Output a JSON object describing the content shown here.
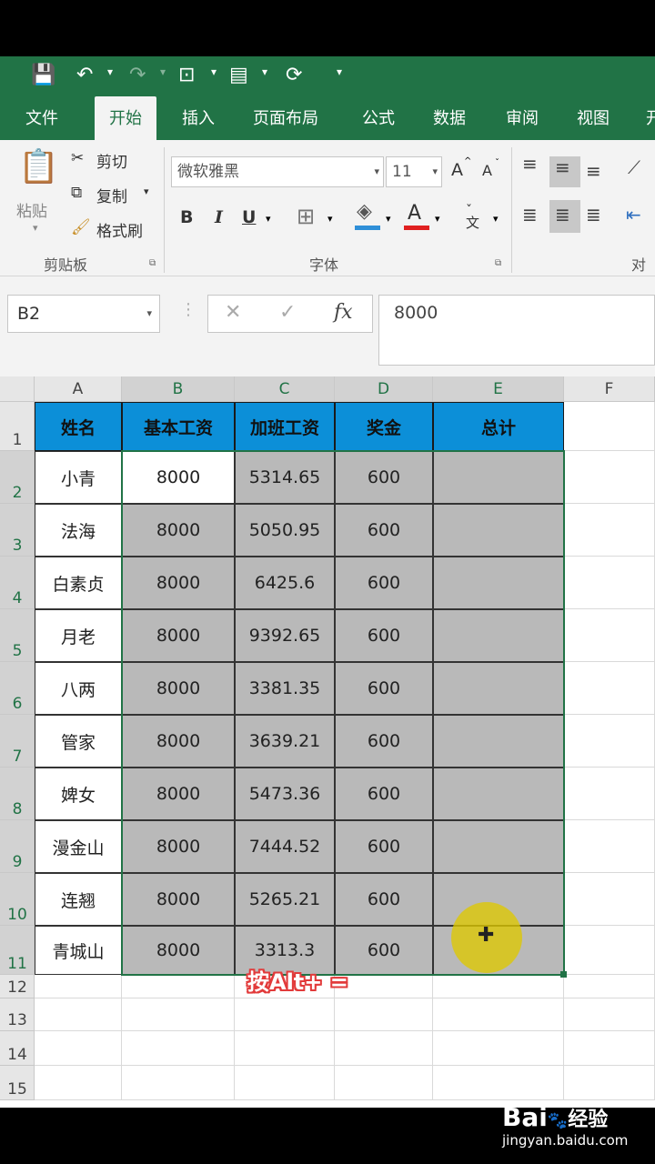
{
  "ribbon_tabs": [
    "文件",
    "开始",
    "插入",
    "页面布局",
    "公式",
    "数据",
    "审阅",
    "视图",
    "开"
  ],
  "active_tab": "开始",
  "clipboard": {
    "paste": "粘贴",
    "cut": "剪切",
    "copy": "复制",
    "format_painter": "格式刷",
    "group": "剪贴板"
  },
  "font": {
    "name": "微软雅黑",
    "size": "11",
    "grow": "A",
    "shrink": "A",
    "bold": "B",
    "italic": "I",
    "underline": "U",
    "color_letter": "A",
    "wen": "文",
    "group": "字体"
  },
  "align": {
    "group": "对齐"
  },
  "formula_bar": {
    "name_box": "B2",
    "cancel": "✕",
    "enter": "✓",
    "fx": "fx",
    "value": "8000"
  },
  "columns": [
    "A",
    "B",
    "C",
    "D",
    "E",
    "F"
  ],
  "rows": [
    "1",
    "2",
    "3",
    "4",
    "5",
    "6",
    "7",
    "8",
    "9",
    "10",
    "11",
    "12",
    "13",
    "14",
    "15"
  ],
  "table": {
    "headers": [
      "姓名",
      "基本工资",
      "加班工资",
      "奖金",
      "总计"
    ],
    "rows": [
      [
        "小青",
        "8000",
        "5314.65",
        "600",
        ""
      ],
      [
        "法海",
        "8000",
        "5050.95",
        "600",
        ""
      ],
      [
        "白素贞",
        "8000",
        "6425.6",
        "600",
        ""
      ],
      [
        "月老",
        "8000",
        "9392.65",
        "600",
        ""
      ],
      [
        "八两",
        "8000",
        "3381.35",
        "600",
        ""
      ],
      [
        "管家",
        "8000",
        "3639.21",
        "600",
        ""
      ],
      [
        "婢女",
        "8000",
        "5473.36",
        "600",
        ""
      ],
      [
        "漫金山",
        "8000",
        "7444.52",
        "600",
        ""
      ],
      [
        "连翘",
        "8000",
        "5265.21",
        "600",
        ""
      ],
      [
        "青城山",
        "8000",
        "3313.3",
        "600",
        ""
      ]
    ]
  },
  "caption": "按Alt+ =",
  "watermark": {
    "logo": "Bai",
    "logo_cn": "经验",
    "url": "jingyan.baidu.com"
  },
  "colors": {
    "excel_green": "#217346",
    "header_blue": "#0c8fd8",
    "selection_gray": "#b9b9b9",
    "cursor_yellow": "#dec800"
  }
}
